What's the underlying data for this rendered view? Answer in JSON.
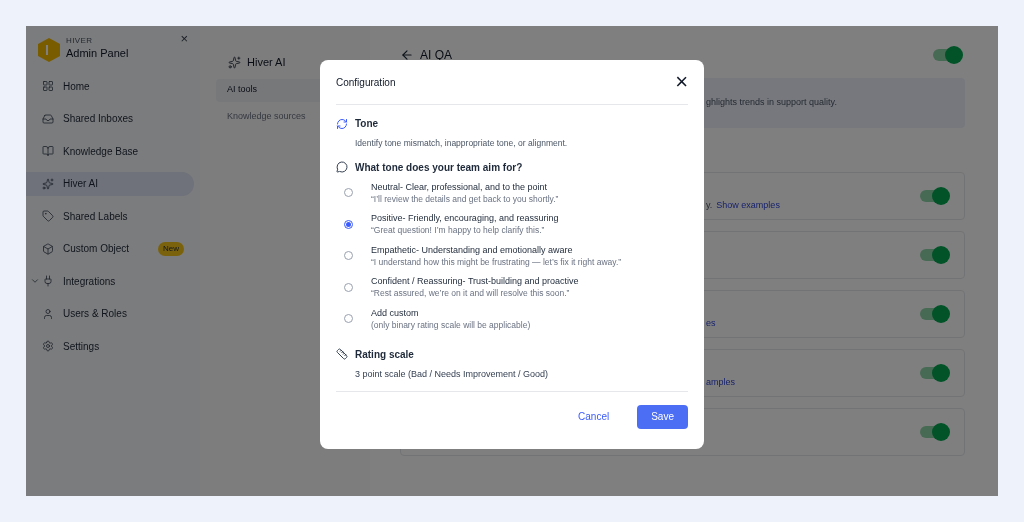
{
  "sidebar": {
    "brand": "HIVER",
    "title": "Admin Panel",
    "close": "×",
    "items": [
      {
        "label": "Home",
        "selected": false
      },
      {
        "label": "Shared Inboxes",
        "selected": false
      },
      {
        "label": "Knowledge Base",
        "selected": false
      },
      {
        "label": "Hiver AI",
        "selected": true
      },
      {
        "label": "Shared Labels",
        "selected": false
      },
      {
        "label": "Custom Object",
        "selected": false,
        "badge": "New"
      },
      {
        "label": "Integrations",
        "selected": false,
        "expanded": false
      },
      {
        "label": "Users & Roles",
        "selected": false
      },
      {
        "label": "Settings",
        "selected": false
      }
    ]
  },
  "subnav": {
    "title": "Hiver AI",
    "items": [
      {
        "label": "AI tools",
        "selected": true
      },
      {
        "label": "Knowledge sources",
        "selected": false
      }
    ]
  },
  "main": {
    "title": "AI QA",
    "toggle_on": true,
    "banner": "ghlights trends in support quality.",
    "cards": [
      {
        "text": "y.",
        "link": "Show examples",
        "on": true
      },
      {
        "on": true
      },
      {
        "link": "es",
        "on": true
      },
      {
        "link": "amples",
        "on": true
      },
      {
        "on": true
      }
    ]
  },
  "modal": {
    "title": "Configuration",
    "close": "×",
    "tone": {
      "title": "Tone",
      "description": "Identify tone mismatch, inappropriate tone, or alignment."
    },
    "question": "What tone does your team aim for?",
    "options": [
      {
        "label": "Neutral- Clear, professional, and to the point",
        "hint": "“I’ll review the details and get back to you shortly.”",
        "selected": false
      },
      {
        "label": "Positive- Friendly, encouraging, and reassuring",
        "hint": "“Great question! I’m happy to help clarify this.”",
        "selected": true
      },
      {
        "label": "Empathetic- Understanding and emotionally aware",
        "hint": "“I understand how this might be frustrating — let’s fix it right away.”",
        "selected": false
      },
      {
        "label": "Confident / Reassuring- Trust-building and proactive",
        "hint": "“Rest assured, we’re on it and will resolve this soon.”",
        "selected": false
      },
      {
        "label": "Add custom",
        "hint": "(only binary rating scale will be applicable)",
        "selected": false
      }
    ],
    "rating": {
      "title": "Rating scale",
      "value": "3 point scale (Bad / Needs Improvement / Good)"
    },
    "buttons": {
      "cancel": "Cancel",
      "save": "Save"
    }
  }
}
